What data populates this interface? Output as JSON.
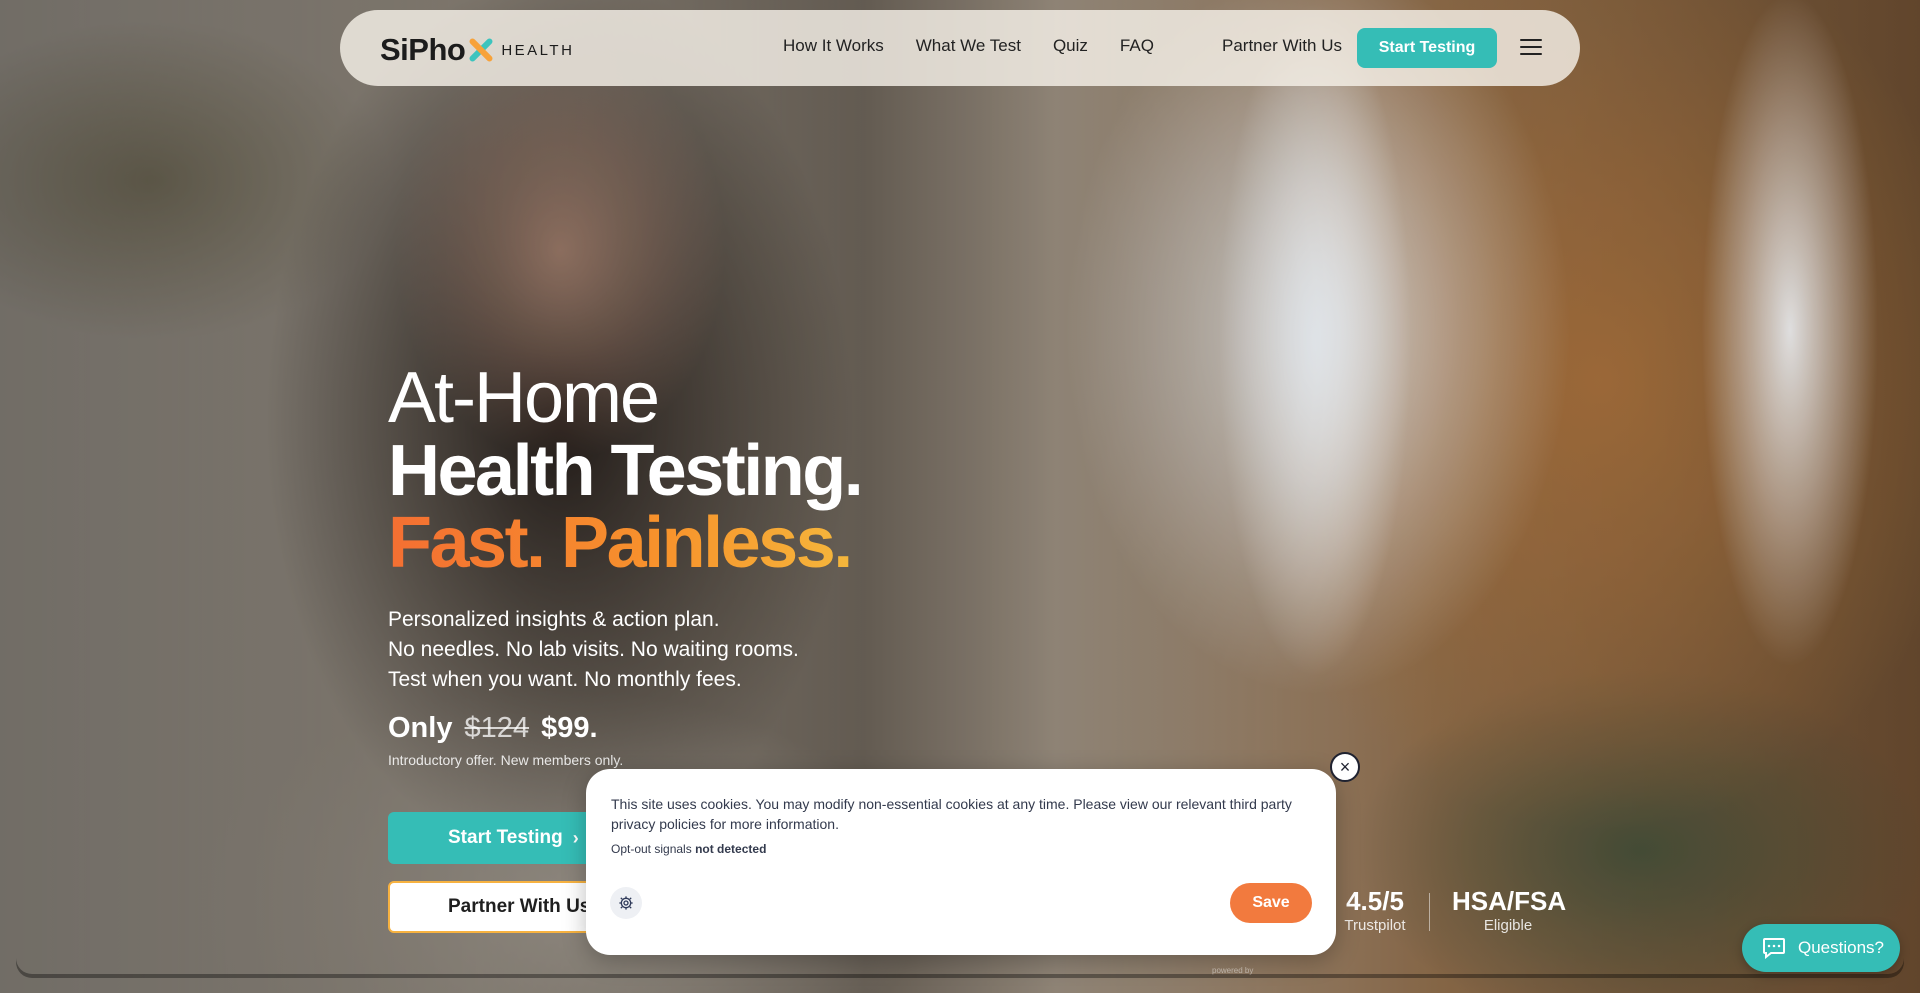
{
  "brand": {
    "name": "SiPho",
    "health": "HEALTH",
    "colors": {
      "teal": "#35bdb6",
      "orange": "#f27a3e"
    }
  },
  "nav": {
    "items": [
      "How It Works",
      "What We Test",
      "Quiz",
      "FAQ"
    ],
    "partner": "Partner With Us",
    "start": "Start Testing",
    "menu_icon": "hamburger-icon"
  },
  "hero": {
    "line1": "At-Home",
    "line2": "Health Testing.",
    "line3": "Fast. Painless.",
    "sub": [
      "Personalized insights & action plan.",
      "No needles. No lab visits. No waiting rooms.",
      "Test when you want. No monthly fees."
    ],
    "price_prefix": "Only",
    "price_old": "$124",
    "price_new": "$99.",
    "offer_note": "Introductory offer. New members only.",
    "cta_start": "Start Testing",
    "cta_partner": "Partner With Us"
  },
  "stats": [
    {
      "big": "4.5/5",
      "small": "Trustpilot"
    },
    {
      "big": "HSA/FSA",
      "small": "Eligible"
    }
  ],
  "cookie": {
    "text": "This site uses cookies. You may modify non-essential cookies at any time. Please view our relevant third party privacy policies for more information.",
    "opt_label": "Opt-out signals",
    "opt_status": "not detected",
    "save": "Save",
    "powered": "powered by"
  },
  "chat": {
    "label": "Questions?"
  }
}
